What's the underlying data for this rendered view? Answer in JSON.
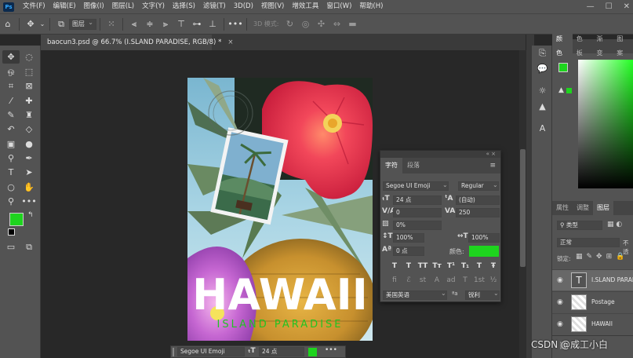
{
  "app": {
    "logo": "Ps"
  },
  "menu": [
    "文件(F)",
    "编辑(E)",
    "图像(I)",
    "图层(L)",
    "文字(Y)",
    "选择(S)",
    "滤镜(T)",
    "3D(D)",
    "视图(V)",
    "增效工具",
    "窗口(W)",
    "帮助(H)"
  ],
  "window_controls": [
    "—",
    "☐",
    "✕"
  ],
  "options_bar": {
    "layer_select": "图层",
    "mode_3d": "3D 模式:",
    "more": "•••"
  },
  "document_tab": {
    "title": "baocun3.psd @ 66.7% (I.SLAND PARADISE, RGB/8) *",
    "close": "×"
  },
  "artwork": {
    "headline": "HAWAII",
    "subline": "ISLAND PARADISE",
    "headline_color": "#ffffff",
    "subline_color": "#22c322"
  },
  "character_panel": {
    "collapse": "«  ×",
    "tabs": [
      "字符",
      "段落"
    ],
    "font_family": "Segoe UI Emoji",
    "font_style": "Regular",
    "font_size": "24 点",
    "leading": "(自动)",
    "kerning": "0",
    "tracking": "250",
    "tsume": "0%",
    "vertical_scale": "100%",
    "horizontal_scale": "100%",
    "baseline_shift": "0 点",
    "color_label": "颜色:",
    "color": "#1ed41e",
    "style_buttons": [
      "T",
      "T",
      "TT",
      "Tт",
      "T¹",
      "T₁",
      "T",
      "Ŧ"
    ],
    "opentype_buttons": [
      "fi",
      "ℰ",
      "st",
      "A",
      "ad",
      "T",
      "1st",
      "½"
    ],
    "language": "美国英语",
    "aa_label": "ªa",
    "antialias": "锐利"
  },
  "context_bar": {
    "font": "Segoe UI Emoji",
    "size": "24 点",
    "color": "#1ed41e",
    "more": "•••"
  },
  "right_panel": {
    "color_tabs": [
      "颜色",
      "色板",
      "渐变",
      "图案"
    ],
    "foreground": "#1ed41e",
    "layer_tabs": [
      "属性",
      "调整",
      "图层"
    ],
    "filter_label": "类型",
    "blend_mode": "正常",
    "opacity_label": "不透",
    "lock_label": "锁定:",
    "layers": [
      {
        "name": "I.SLAND PARADI",
        "type": "text"
      },
      {
        "name": "Postage",
        "type": "smart"
      },
      {
        "name": "HAWAII",
        "type": "smart"
      }
    ]
  },
  "watermark": "CSDN @成工小白"
}
